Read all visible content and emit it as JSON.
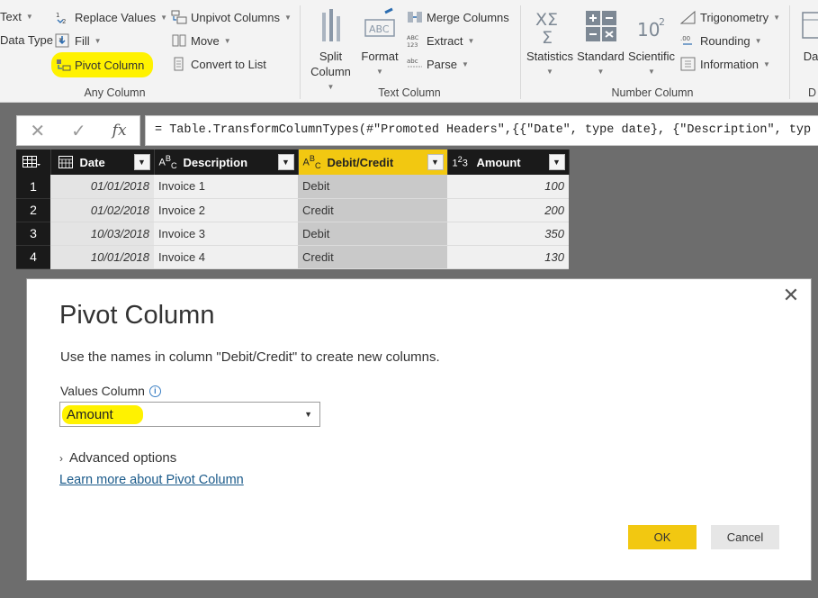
{
  "ribbon": {
    "left_col": {
      "text": "Text",
      "data_type": "Data Type"
    },
    "any_column": {
      "replace_values": "Replace Values",
      "fill": "Fill",
      "pivot_column": "Pivot Column",
      "unpivot_columns": "Unpivot Columns",
      "move": "Move",
      "convert_to_list": "Convert to List",
      "group_label": "Any Column"
    },
    "text_column": {
      "split_column_1": "Split",
      "split_column_2": "Column",
      "format": "Format",
      "merge_columns": "Merge Columns",
      "extract": "Extract",
      "parse": "Parse",
      "group_label": "Text Column"
    },
    "number_column": {
      "statistics": "Statistics",
      "standard": "Standard",
      "scientific": "Scientific",
      "trigonometry": "Trigonometry",
      "rounding": "Rounding",
      "information": "Information",
      "group_label": "Number Column"
    },
    "right_cut": {
      "label": "Da",
      "group_label": "D"
    },
    "highlight_color": "#fff200"
  },
  "formula_bar": {
    "cancel": "✕",
    "confirm": "✓",
    "fx": "fx",
    "expression": "= Table.TransformColumnTypes(#\"Promoted Headers\",{{\"Date\", type date}, {\"Description\", typ"
  },
  "table": {
    "columns": [
      {
        "type_icon": "▦",
        "name": "Date"
      },
      {
        "type_icon": "ABC",
        "name": "Description"
      },
      {
        "type_icon": "ABC",
        "name": "Debit/Credit"
      },
      {
        "type_icon": "123",
        "name": "Amount"
      }
    ],
    "rows": [
      {
        "n": "1",
        "date": "01/01/2018",
        "desc": "Invoice 1",
        "dc": "Debit",
        "amount": "100"
      },
      {
        "n": "2",
        "date": "01/02/2018",
        "desc": "Invoice 2",
        "dc": "Credit",
        "amount": "200"
      },
      {
        "n": "3",
        "date": "10/03/2018",
        "desc": "Invoice 3",
        "dc": "Debit",
        "amount": "350"
      },
      {
        "n": "4",
        "date": "10/01/2018",
        "desc": "Invoice 4",
        "dc": "Credit",
        "amount": "130"
      }
    ],
    "selected_header_color": "#f2c811"
  },
  "dialog": {
    "title": "Pivot Column",
    "instruction": "Use the names in column \"Debit/Credit\" to create new columns.",
    "values_column_label": "Values Column",
    "values_column_value": "Amount",
    "advanced_options": "Advanced options",
    "learn_more": "Learn more about Pivot Column",
    "ok": "OK",
    "cancel": "Cancel",
    "close": "✕"
  }
}
